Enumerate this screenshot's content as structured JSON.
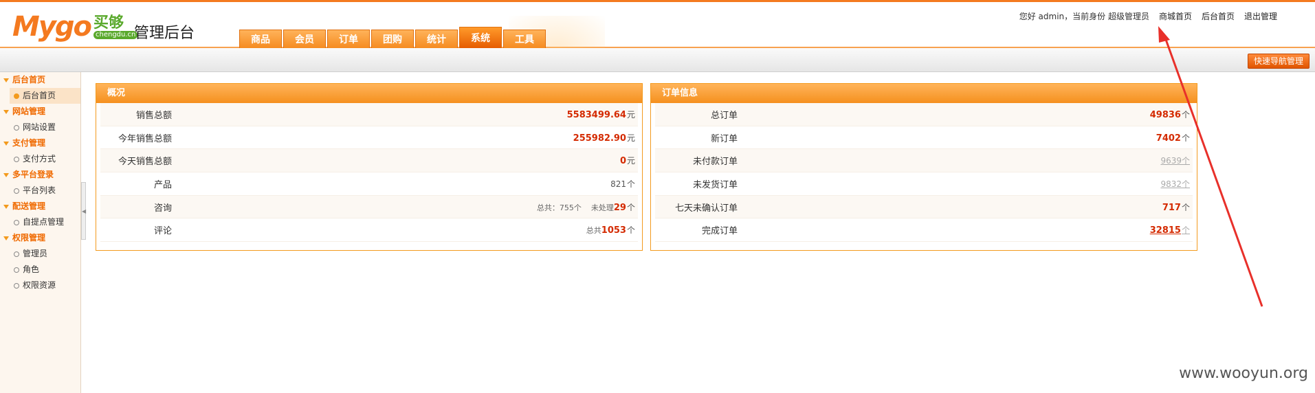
{
  "header": {
    "logo_text": "Mygo",
    "logo_cn": "买够",
    "logo_sub": "chengdu.cn",
    "site_title": "管理后台",
    "greeting": "您好 admin，当前身份 超级管理员",
    "links": [
      "商城首页",
      "后台首页",
      "退出管理"
    ]
  },
  "nav": {
    "tabs": [
      "商品",
      "会员",
      "订单",
      "团购",
      "统计",
      "系统",
      "工具"
    ],
    "active_index": 5
  },
  "subbar": {
    "quick_nav_label": "快速导航管理"
  },
  "sidebar": {
    "groups": [
      {
        "title": "后台首页",
        "items": [
          "后台首页"
        ]
      },
      {
        "title": "网站管理",
        "items": [
          "网站设置"
        ]
      },
      {
        "title": "支付管理",
        "items": [
          "支付方式"
        ]
      },
      {
        "title": "多平台登录",
        "items": [
          "平台列表"
        ]
      },
      {
        "title": "配送管理",
        "items": [
          "自提点管理"
        ]
      },
      {
        "title": "权限管理",
        "items": [
          "管理员",
          "角色",
          "权限资源"
        ]
      }
    ],
    "active_item": "后台首页"
  },
  "overview": {
    "title": "概况",
    "rows": {
      "sales_total": {
        "label": "销售总额",
        "value": "5583499.64",
        "unit": "元"
      },
      "year_sales": {
        "label": "今年销售总额",
        "value": "255982.90",
        "unit": "元"
      },
      "today_sales": {
        "label": "今天销售总额",
        "value": "0",
        "unit": "元"
      },
      "products": {
        "label": "产品",
        "value": "821",
        "unit": "个"
      },
      "inquiries": {
        "label": "咨询",
        "total_text": "总共：755个",
        "pending_prefix": "未处理",
        "pending_value": "29",
        "unit": "个"
      },
      "comments": {
        "label": "评论",
        "prefix": "总共",
        "value": "1053",
        "unit": "个"
      }
    }
  },
  "orders": {
    "title": "订单信息",
    "rows": {
      "total": {
        "label": "总订单",
        "value": "49836",
        "unit": "个"
      },
      "new": {
        "label": "新订单",
        "value": "7402",
        "unit": "个"
      },
      "unpaid": {
        "label": "未付款订单",
        "value": "9639个"
      },
      "unshipped": {
        "label": "未发货订单",
        "value": "9832个"
      },
      "unconfirmed": {
        "label": "七天未确认订单",
        "value": "717",
        "unit": "个"
      },
      "completed": {
        "label": "完成订单",
        "value": "32815",
        "unit": "个"
      }
    }
  },
  "watermark": "www.wooyun.org",
  "colors": {
    "accent": "#f39a1d",
    "value_red": "#d42a00",
    "arrow": "#e8302a"
  }
}
